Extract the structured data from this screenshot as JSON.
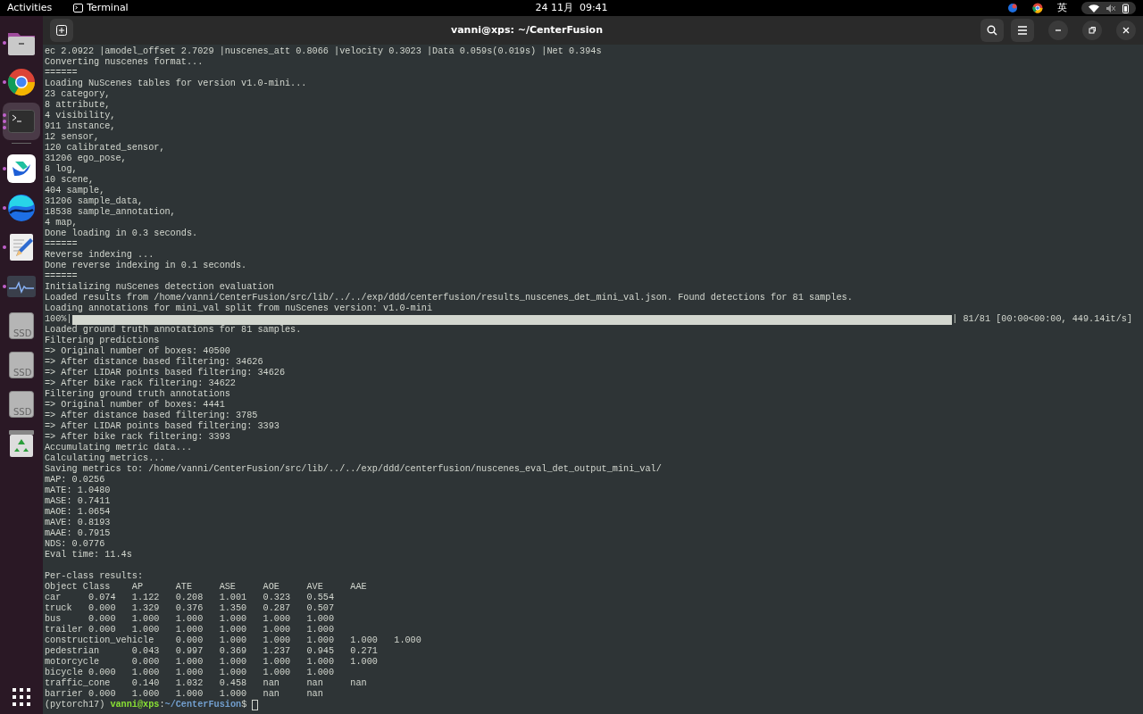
{
  "top_bar": {
    "activities": "Activities",
    "app_name": "Terminal",
    "clock": "24 11月  09:41",
    "input_method": "英"
  },
  "dock": {
    "items": [
      {
        "kind": "folder",
        "running": true,
        "selected": false
      },
      {
        "kind": "chrome",
        "running": true,
        "selected": false
      },
      {
        "kind": "terminal",
        "running": true,
        "selected": true
      },
      {
        "kind": "separator"
      },
      {
        "kind": "feishu",
        "running": true,
        "selected": false
      },
      {
        "kind": "orb",
        "running": true,
        "selected": false
      },
      {
        "kind": "editor",
        "running": true,
        "selected": false
      },
      {
        "kind": "monitor",
        "running": true,
        "selected": false
      },
      {
        "kind": "drive",
        "label": "SSD",
        "running": false,
        "selected": false
      },
      {
        "kind": "drive",
        "label": "SSD",
        "running": false,
        "selected": false
      },
      {
        "kind": "drive",
        "label": "SSD",
        "running": false,
        "selected": false
      },
      {
        "kind": "trash",
        "running": false,
        "selected": false
      }
    ]
  },
  "window": {
    "title": "vanni@xps: ~/CenterFusion"
  },
  "terminal": {
    "lines": [
      {
        "kind": "text",
        "text": "ec 2.0922 |amodel_offset 2.7029 |nuscenes_att 0.8066 |velocity 0.3023 |Data 0.059s(0.019s) |Net 0.394s"
      },
      {
        "kind": "text",
        "text": "Converting nuscenes format..."
      },
      {
        "kind": "text",
        "text": "======"
      },
      {
        "kind": "text",
        "text": "Loading NuScenes tables for version v1.0-mini..."
      },
      {
        "kind": "text",
        "text": "23 category,"
      },
      {
        "kind": "text",
        "text": "8 attribute,"
      },
      {
        "kind": "text",
        "text": "4 visibility,"
      },
      {
        "kind": "text",
        "text": "911 instance,"
      },
      {
        "kind": "text",
        "text": "12 sensor,"
      },
      {
        "kind": "text",
        "text": "120 calibrated_sensor,"
      },
      {
        "kind": "text",
        "text": "31206 ego_pose,"
      },
      {
        "kind": "text",
        "text": "8 log,"
      },
      {
        "kind": "text",
        "text": "10 scene,"
      },
      {
        "kind": "text",
        "text": "404 sample,"
      },
      {
        "kind": "text",
        "text": "31206 sample_data,"
      },
      {
        "kind": "text",
        "text": "18538 sample_annotation,"
      },
      {
        "kind": "text",
        "text": "4 map,"
      },
      {
        "kind": "text",
        "text": "Done loading in 0.3 seconds."
      },
      {
        "kind": "text",
        "text": "======"
      },
      {
        "kind": "text",
        "text": "Reverse indexing ..."
      },
      {
        "kind": "text",
        "text": "Done reverse indexing in 0.1 seconds."
      },
      {
        "kind": "text",
        "text": "======"
      },
      {
        "kind": "text",
        "text": "Initializing nuScenes detection evaluation"
      },
      {
        "kind": "text",
        "text": "Loaded results from /home/vanni/CenterFusion/src/lib/../../exp/ddd/centerfusion/results_nuscenes_det_mini_val.json. Found detections for 81 samples."
      },
      {
        "kind": "text",
        "text": "Loading annotations for mini_val split from nuScenes version: v1.0-mini"
      },
      {
        "kind": "progress",
        "prefix": "100%|",
        "level": 1.0,
        "suffix": "| 81/81 [00:00<00:00, 449.14it/s]"
      },
      {
        "kind": "text",
        "text": "Loaded ground truth annotations for 81 samples."
      },
      {
        "kind": "text",
        "text": "Filtering predictions"
      },
      {
        "kind": "text",
        "text": "=> Original number of boxes: 40500"
      },
      {
        "kind": "text",
        "text": "=> After distance based filtering: 34626"
      },
      {
        "kind": "text",
        "text": "=> After LIDAR points based filtering: 34626"
      },
      {
        "kind": "text",
        "text": "=> After bike rack filtering: 34622"
      },
      {
        "kind": "text",
        "text": "Filtering ground truth annotations"
      },
      {
        "kind": "text",
        "text": "=> Original number of boxes: 4441"
      },
      {
        "kind": "text",
        "text": "=> After distance based filtering: 3785"
      },
      {
        "kind": "text",
        "text": "=> After LIDAR points based filtering: 3393"
      },
      {
        "kind": "text",
        "text": "=> After bike rack filtering: 3393"
      },
      {
        "kind": "text",
        "text": "Accumulating metric data..."
      },
      {
        "kind": "text",
        "text": "Calculating metrics..."
      },
      {
        "kind": "text",
        "text": "Saving metrics to: /home/vanni/CenterFusion/src/lib/../../exp/ddd/centerfusion/nuscenes_eval_det_output_mini_val/"
      },
      {
        "kind": "text",
        "text": "mAP: 0.0256"
      },
      {
        "kind": "text",
        "text": "mATE: 1.0480"
      },
      {
        "kind": "text",
        "text": "mASE: 0.7411"
      },
      {
        "kind": "text",
        "text": "mAOE: 1.0654"
      },
      {
        "kind": "text",
        "text": "mAVE: 0.8193"
      },
      {
        "kind": "text",
        "text": "mAAE: 0.7915"
      },
      {
        "kind": "text",
        "text": "NDS: 0.0776"
      },
      {
        "kind": "text",
        "text": "Eval time: 11.4s"
      },
      {
        "kind": "blank"
      },
      {
        "kind": "text",
        "text": "Per-class results:"
      },
      {
        "kind": "text",
        "text": "Object Class\tAP\tATE\tASE\tAOE\tAVE\tAAE"
      },
      {
        "kind": "text",
        "text": "car\t0.074\t1.122\t0.208\t1.001\t0.323\t0.554"
      },
      {
        "kind": "text",
        "text": "truck\t0.000\t1.329\t0.376\t1.350\t0.287\t0.507"
      },
      {
        "kind": "text",
        "text": "bus\t0.000\t1.000\t1.000\t1.000\t1.000\t1.000"
      },
      {
        "kind": "text",
        "text": "trailer\t0.000\t1.000\t1.000\t1.000\t1.000\t1.000"
      },
      {
        "kind": "text",
        "text": "construction_vehicle\t0.000\t1.000\t1.000\t1.000\t1.000\t1.000"
      },
      {
        "kind": "text",
        "text": "pedestrian\t0.043\t0.997\t0.369\t1.237\t0.945\t0.271"
      },
      {
        "kind": "text",
        "text": "motorcycle\t0.000\t1.000\t1.000\t1.000\t1.000\t1.000"
      },
      {
        "kind": "text",
        "text": "bicycle\t0.000\t1.000\t1.000\t1.000\t1.000\t1.000"
      },
      {
        "kind": "text",
        "text": "traffic_cone\t0.140\t1.032\t0.458\tnan\tnan\tnan"
      },
      {
        "kind": "text",
        "text": "barrier\t0.000\t1.000\t1.000\t1.000\tnan\tnan"
      },
      {
        "kind": "prompt",
        "env": "(pytorch17) ",
        "user": "vanni@xps",
        "sep": ":",
        "path": "~/CenterFusion",
        "symbol": "$ "
      }
    ]
  }
}
